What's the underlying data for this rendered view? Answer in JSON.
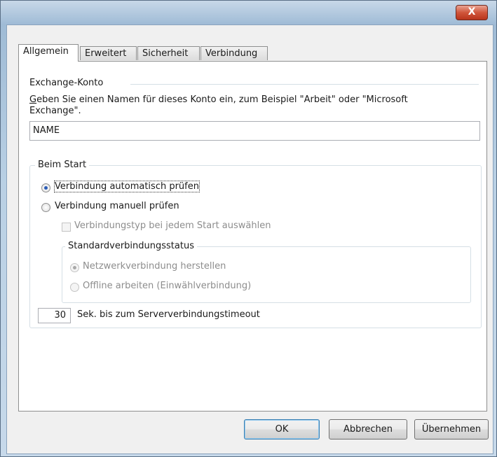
{
  "window": {
    "close_glyph": "X"
  },
  "tabs": [
    "Allgemein",
    "Erweitert",
    "Sicherheit",
    "Verbindung"
  ],
  "account": {
    "section_title": "Exchange-Konto",
    "instruction_line1": "Geben Sie einen Namen für dieses Konto ein, zum Beispiel \"Arbeit\" oder \"Microsoft",
    "instruction_line2": "Exchange\".",
    "name_value": "NAME"
  },
  "startup": {
    "group_title": "Beim Start",
    "auto_check": {
      "label": "Verbindung automatisch prüfen",
      "checked": true
    },
    "manual_check": {
      "label": "Verbindung manuell prüfen",
      "checked": false
    },
    "choose_type": {
      "label": "Verbindungstyp bei jedem Start auswählen",
      "checked": false
    },
    "default_status": {
      "group_title": "Standardverbindungsstatus",
      "network": {
        "label": "Netzwerkverbindung herstellen",
        "checked": true
      },
      "offline": {
        "label": "Offline arbeiten (Einwählverbindung)",
        "checked": false
      }
    },
    "timeout_value": "30",
    "timeout_label": "Sek. bis zum Serververbindungstimeout"
  },
  "buttons": {
    "ok": "OK",
    "cancel": "Abbrechen",
    "apply": "Übernehmen"
  }
}
